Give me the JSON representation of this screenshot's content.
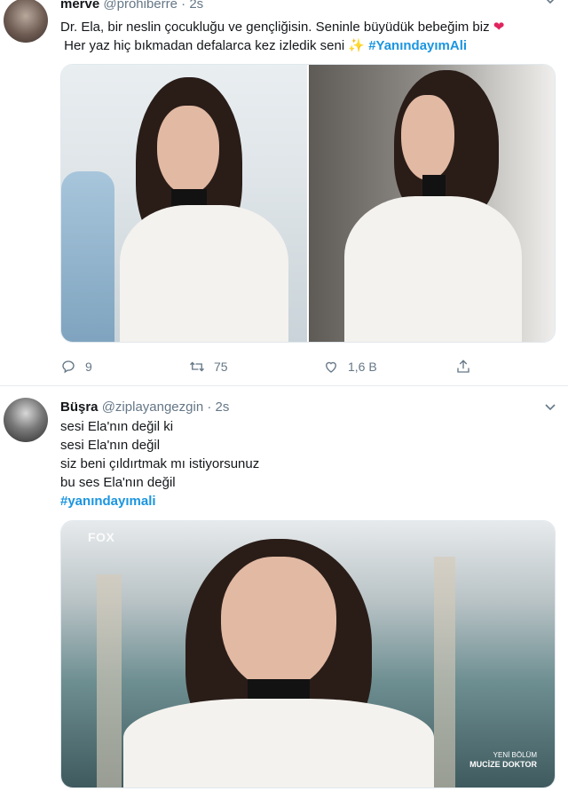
{
  "tweets": [
    {
      "user": {
        "name": "merve",
        "handle": "@prohiberre",
        "separator": "·",
        "time": "2s"
      },
      "text_lines": [
        "Dr. Ela, bir neslin çocukluğu ve gençliğisin. Seninle büyüdük bebeğim biz",
        "Her yaz hiç bıkmadan defalarca kez izledik seni"
      ],
      "emoji_heart": "❤",
      "emoji_sparkle": "✨",
      "hashtag": "#YanındayımAli",
      "actions": {
        "reply_count": "9",
        "retweet_count": "75",
        "like_count": "1,6 B"
      }
    },
    {
      "user": {
        "name": "Büşra",
        "handle": "@ziplayangezgin",
        "separator": "·",
        "time": "2s"
      },
      "text_lines": [
        "sesi Ela'nın değil ki",
        "sesi Ela'nın değil",
        "siz beni çıldırtmak mı istiyorsunuz",
        "bu ses Ela'nın değil"
      ],
      "hashtag": "#yanındayımali",
      "media": {
        "watermark": "FOX",
        "promo_top": "YENİ BÖLÜM",
        "promo_bottom": "MUCİZE DOKTOR"
      }
    }
  ],
  "colors": {
    "hashtag": "#1b95e0",
    "secondary_text": "#657786",
    "divider": "#e6ecf0",
    "heart": "#e0245e"
  }
}
